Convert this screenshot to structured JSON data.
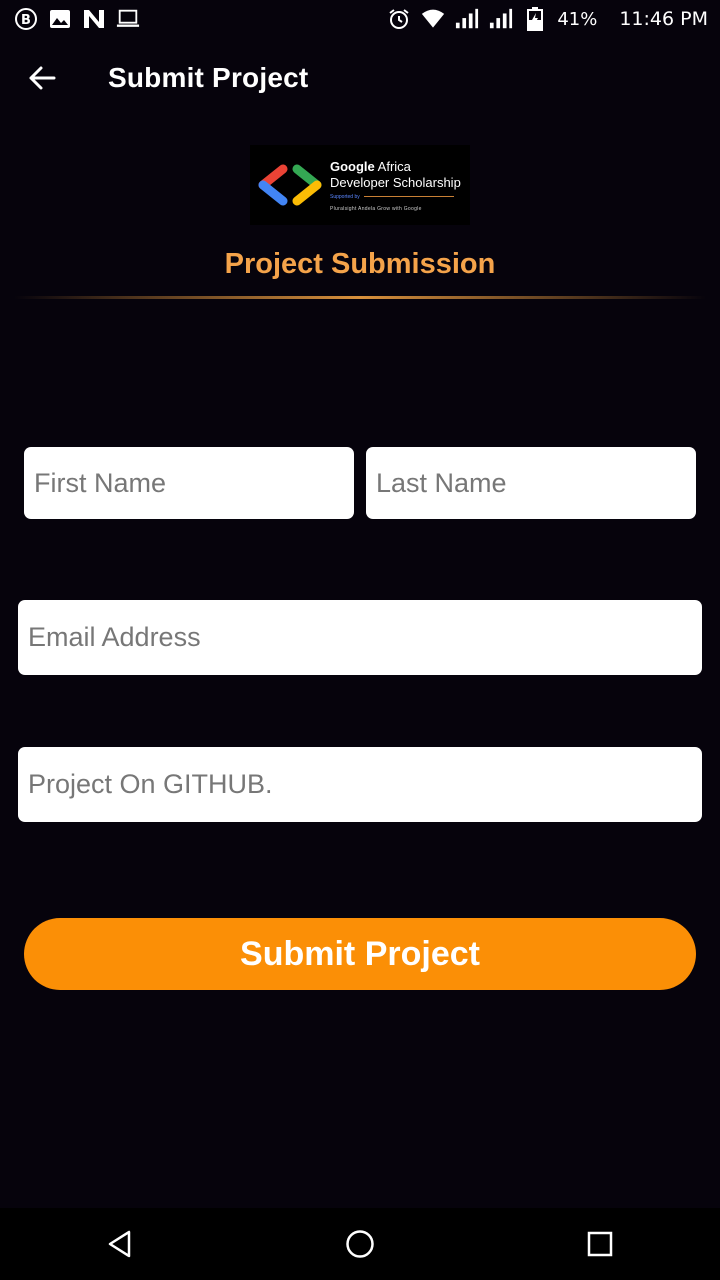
{
  "status_bar": {
    "battery_percent": "41%",
    "time": "11:46 PM",
    "left_icons": [
      "b-badge-icon",
      "image-icon",
      "n-app-icon",
      "laptop-icon"
    ],
    "right_icons": [
      "alarm-icon",
      "wifi-icon",
      "signal-icon",
      "signal-icon",
      "battery-icon"
    ]
  },
  "app_bar": {
    "title": "Submit Project",
    "back_icon": "arrow-left-icon"
  },
  "logo": {
    "line1_bold": "Google",
    "line1_rest": " Africa",
    "line2": "Developer Scholarship",
    "supported_label": "Supported by",
    "partners": "Pluralsight   Andela   Grow with Google"
  },
  "section": {
    "title": "Project Submission"
  },
  "form": {
    "first_name_placeholder": "First Name",
    "last_name_placeholder": "Last Name",
    "email_placeholder": "Email Address",
    "github_placeholder": "Project On GITHUB.",
    "submit_label": "Submit Project"
  },
  "colors": {
    "background": "#06030c",
    "accent_orange": "#fb8f06",
    "title_orange": "#f4a34a"
  },
  "nav_bar": {
    "icons": [
      "nav-back-icon",
      "nav-home-icon",
      "nav-recents-icon"
    ]
  }
}
